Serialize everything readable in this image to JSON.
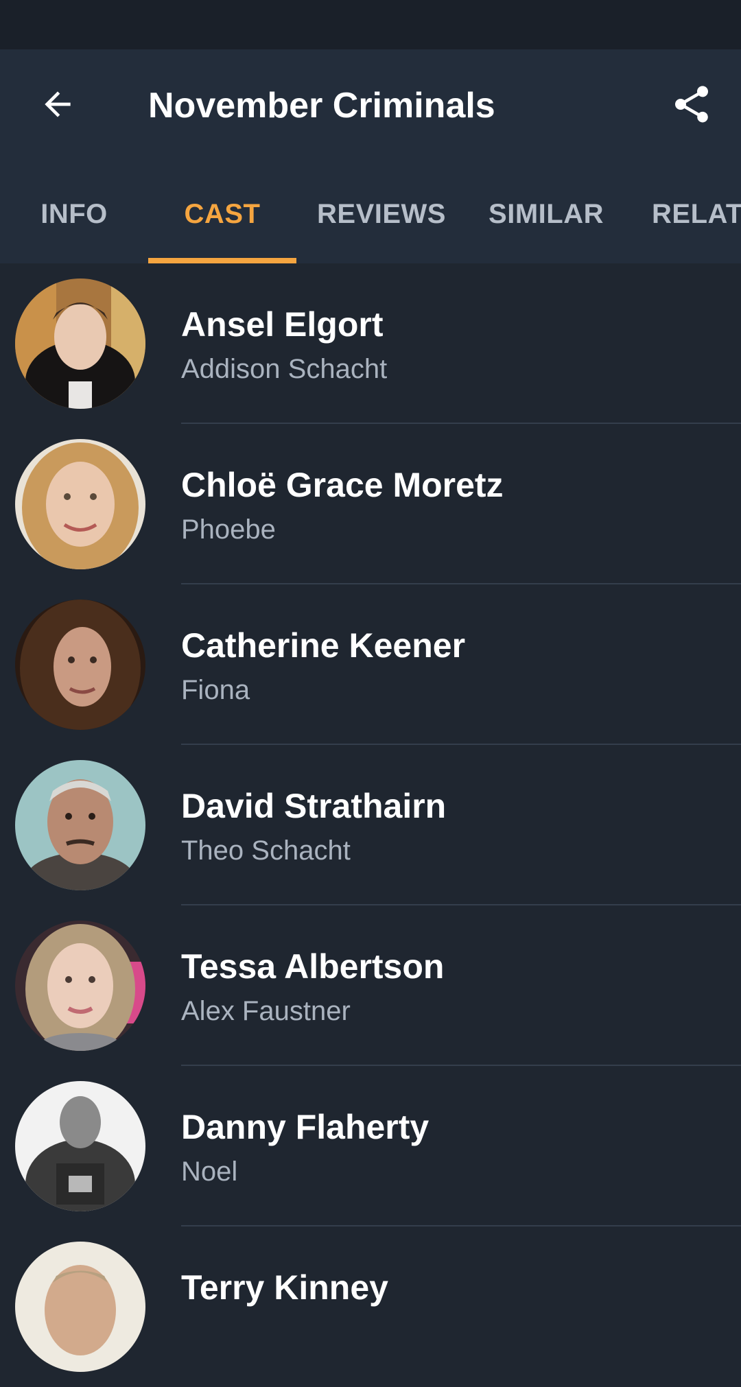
{
  "header": {
    "title": "November Criminals",
    "back_icon": "arrow-left-icon",
    "share_icon": "share-icon"
  },
  "tabs": [
    {
      "label": "INFO",
      "active": false
    },
    {
      "label": "CAST",
      "active": true
    },
    {
      "label": "REVIEWS",
      "active": false
    },
    {
      "label": "SIMILAR",
      "active": false
    },
    {
      "label": "RELATED",
      "active": false
    }
  ],
  "cast": [
    {
      "name": "Ansel Elgort",
      "role": "Addison Schacht"
    },
    {
      "name": "Chloë Grace Moretz",
      "role": "Phoebe"
    },
    {
      "name": "Catherine Keener",
      "role": "Fiona"
    },
    {
      "name": "David Strathairn",
      "role": "Theo Schacht"
    },
    {
      "name": "Tessa Albertson",
      "role": "Alex Faustner"
    },
    {
      "name": "Danny Flaherty",
      "role": "Noel"
    },
    {
      "name": "Terry Kinney",
      "role": ""
    }
  ],
  "colors": {
    "background": "#1f2630",
    "app_bar": "#232d3b",
    "status_bar": "#1a2029",
    "accent": "#f5a540",
    "tab_text": "#b6bec9",
    "secondary_text": "#aab3bf"
  }
}
